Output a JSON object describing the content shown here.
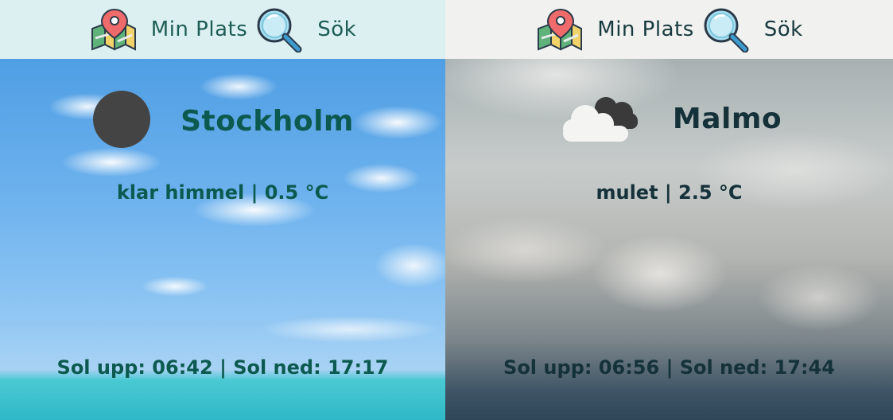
{
  "panels": [
    {
      "nav": {
        "location_label": "Min Plats",
        "search_label": "Sök"
      },
      "city": "Stockholm",
      "description": "klar himmel",
      "separator": "|",
      "temperature": "0.5 °C",
      "weather_icon": "clear-night-icon",
      "sunrise_label": "Sol upp:",
      "sunrise_time": "06:42",
      "sunset_label": "Sol ned:",
      "sunset_time": "17:17",
      "accent_color": "#0c5a4f"
    },
    {
      "nav": {
        "location_label": "Min Plats",
        "search_label": "Sök"
      },
      "city": "Malmo",
      "description": "mulet",
      "separator": "|",
      "temperature": "2.5 °C",
      "weather_icon": "cloudy-icon",
      "sunrise_label": "Sol upp:",
      "sunrise_time": "06:56",
      "sunset_label": "Sol ned:",
      "sunset_time": "17:44",
      "accent_color": "#15313a"
    }
  ]
}
